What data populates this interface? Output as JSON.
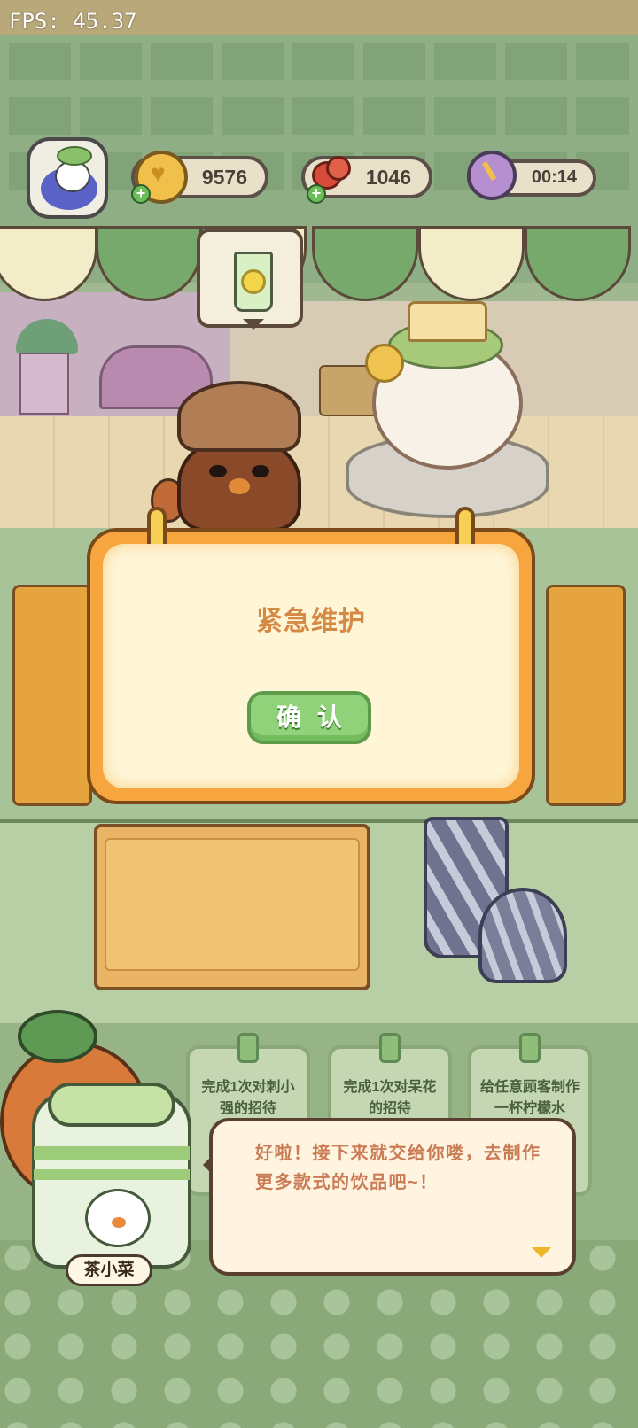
{
  "hud": {
    "fps": "FPS: 45.37",
    "coins": "9576",
    "fruit": "1046",
    "timer": "00:14",
    "plus": "+"
  },
  "modal": {
    "title": "紧急维护",
    "confirm_label": "确认"
  },
  "tasks": [
    {
      "text": "完成1次对刺小强的招待"
    },
    {
      "text": "完成1次对呆花的招待"
    },
    {
      "text": "给任意顾客制作一杯柠檬水"
    }
  ],
  "guide": {
    "name": "茶小菜",
    "dialog": "好啦！接下来就交给你喽，去制作更多款式的饮品吧~！"
  },
  "icons": {
    "avatar": "player-avatar",
    "coins": "coin-icon",
    "fruit": "fruit-icon",
    "timer": "timer-icon",
    "order": "lemonade-icon"
  },
  "colors": {
    "modal_frame": "#f7a63f",
    "modal_title": "#d48a45",
    "confirm_button": "#8fd27a",
    "dialog_text": "#c97c56"
  }
}
